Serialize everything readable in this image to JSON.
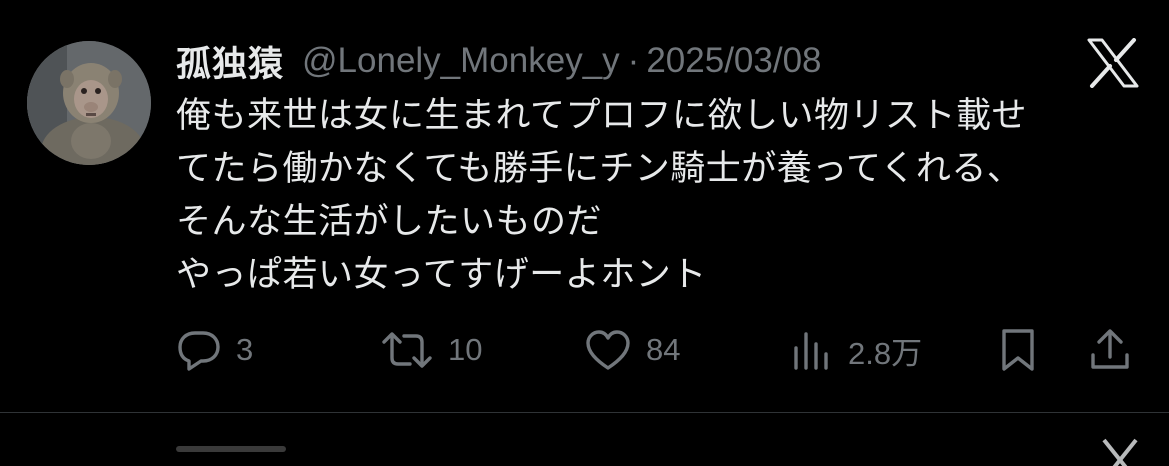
{
  "tweet": {
    "display_name": "孤独猿",
    "handle": "@Lonely_Monkey_y",
    "separator": "·",
    "date": "2025/03/08",
    "text_lines": [
      "俺も来世は女に生まれてプロフに欲しい物リスト載せ",
      "てたら働かなくても勝手にチン騎士が養ってくれる、",
      "そんな生活がしたいものだ",
      "やっぱ若い女ってすげーよホント"
    ],
    "stats": {
      "replies": "3",
      "retweets": "10",
      "likes": "84",
      "views": "2.8万"
    }
  },
  "icons": {
    "logo": "x-logo-icon",
    "avatar": "monkey-avatar",
    "reply": "reply-icon",
    "retweet": "retweet-icon",
    "like": "heart-icon",
    "views": "views-icon",
    "bookmark": "bookmark-icon",
    "share": "share-icon"
  },
  "colors": {
    "background": "#000000",
    "text_primary": "#e7e9ea",
    "text_secondary": "#71767b",
    "divider": "#2f3336"
  }
}
